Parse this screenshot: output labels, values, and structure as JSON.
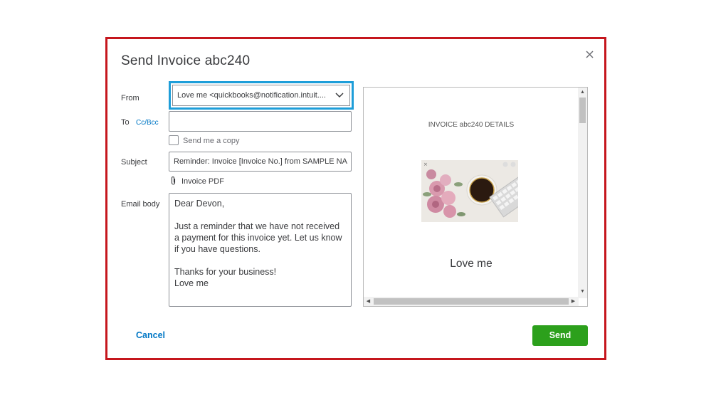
{
  "dialog": {
    "title": "Send Invoice abc240",
    "close_icon": "close-icon"
  },
  "form": {
    "from_label": "From",
    "from_value": "Love me <quickbooks@notification.intuit....",
    "to_label": "To",
    "cc_bcc_link": "Cc/Bcc",
    "to_value": "",
    "send_copy_label": "Send me a copy",
    "send_copy_checked": false,
    "subject_label": "Subject",
    "subject_value": "Reminder: Invoice [Invoice No.] from SAMPLE NA",
    "attachment_icon": "paperclip-icon",
    "attachment_label": "Invoice PDF",
    "email_body_label": "Email body",
    "email_body_value": "Dear Devon,\n\nJust a reminder that we have not received a payment for this invoice yet. Let us know if you have questions.\n\nThanks for your business!\nLove me"
  },
  "preview": {
    "heading": "INVOICE abc240 DETAILS",
    "company_name": "Love me"
  },
  "footer": {
    "cancel_label": "Cancel",
    "send_label": "Send"
  },
  "colors": {
    "highlight_border": "#c5161d",
    "from_focus": "#1e9ed9",
    "link": "#0077c5",
    "send_button": "#2ca01c"
  }
}
